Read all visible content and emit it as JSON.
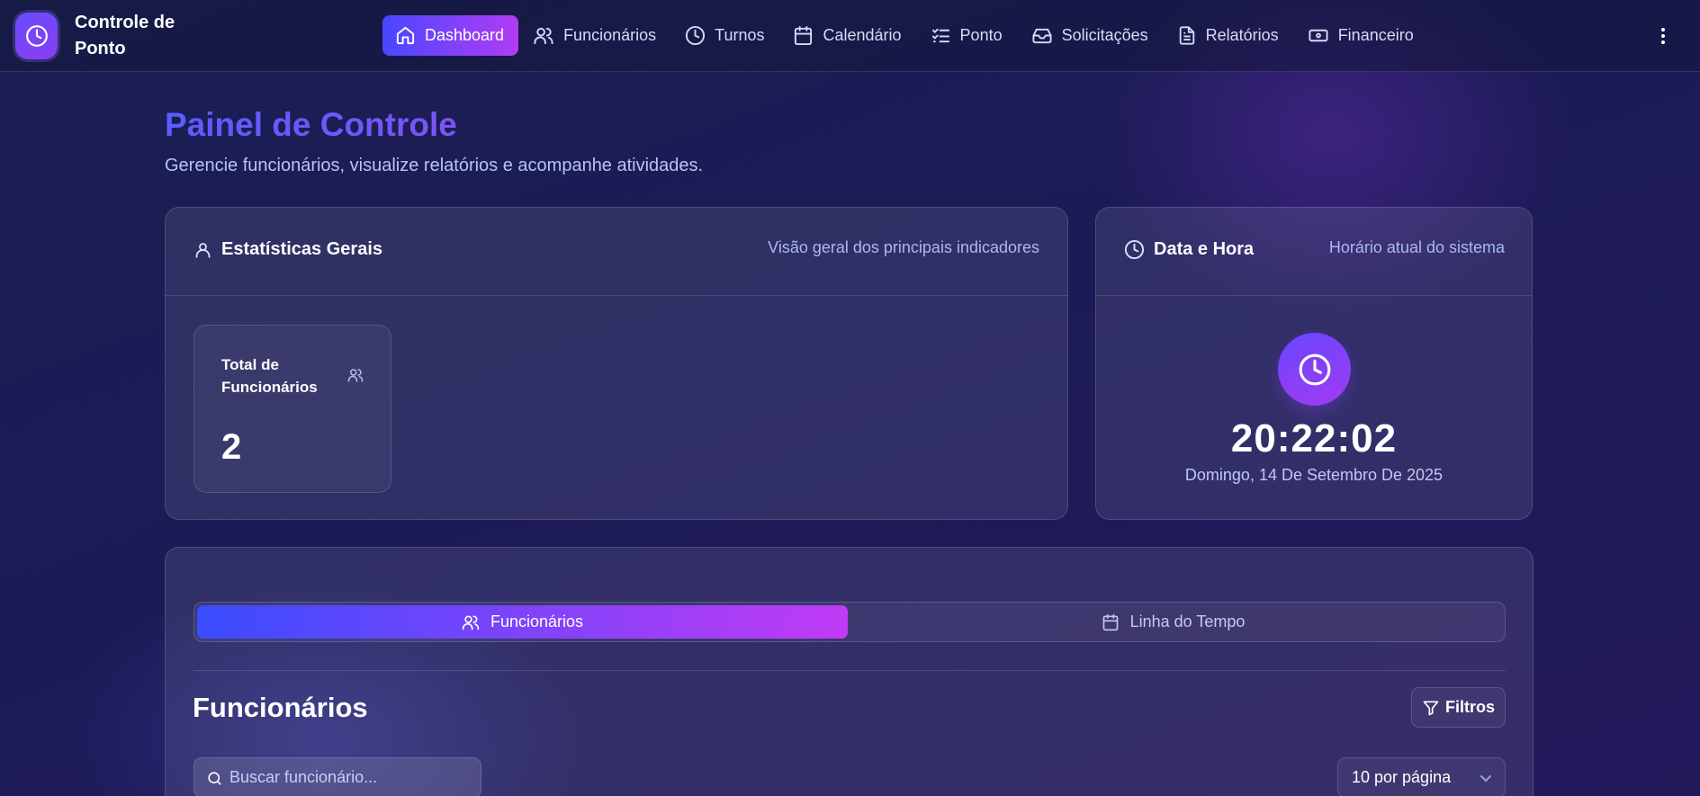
{
  "brand": {
    "title": "Controle de Ponto"
  },
  "nav": [
    {
      "label": "Dashboard",
      "icon": "home-icon",
      "active": true
    },
    {
      "label": "Funcionários",
      "icon": "users-icon"
    },
    {
      "label": "Turnos",
      "icon": "clock-icon"
    },
    {
      "label": "Calendário",
      "icon": "calendar-icon"
    },
    {
      "label": "Ponto",
      "icon": "checklist-icon"
    },
    {
      "label": "Solicitações",
      "icon": "inbox-icon"
    },
    {
      "label": "Relatórios",
      "icon": "file-icon"
    },
    {
      "label": "Financeiro",
      "icon": "banknote-icon"
    }
  ],
  "header": {
    "title": "Painel de Controle",
    "subtitle": "Gerencie funcionários, visualize relatórios e acompanhe atividades."
  },
  "stats_card": {
    "title": "Estatísticas Gerais",
    "description": "Visão geral dos principais indicadores",
    "total_label": "Total de Funcionários",
    "total_value": "2"
  },
  "datetime_card": {
    "title": "Data e Hora",
    "description": "Horário atual do sistema",
    "time": "20:22:02",
    "date": "Domingo, 14 De Setembro De 2025"
  },
  "employees": {
    "tabs": [
      {
        "label": "Funcionários",
        "active": true
      },
      {
        "label": "Linha do Tempo"
      }
    ],
    "title": "Funcionários",
    "filters_label": "Filtros",
    "search_placeholder": "Buscar funcionário...",
    "per_page": "10 por página"
  },
  "colors": {
    "accent_start": "#4a47ff",
    "accent_end": "#b23cf3",
    "background": "#1c1b57"
  }
}
